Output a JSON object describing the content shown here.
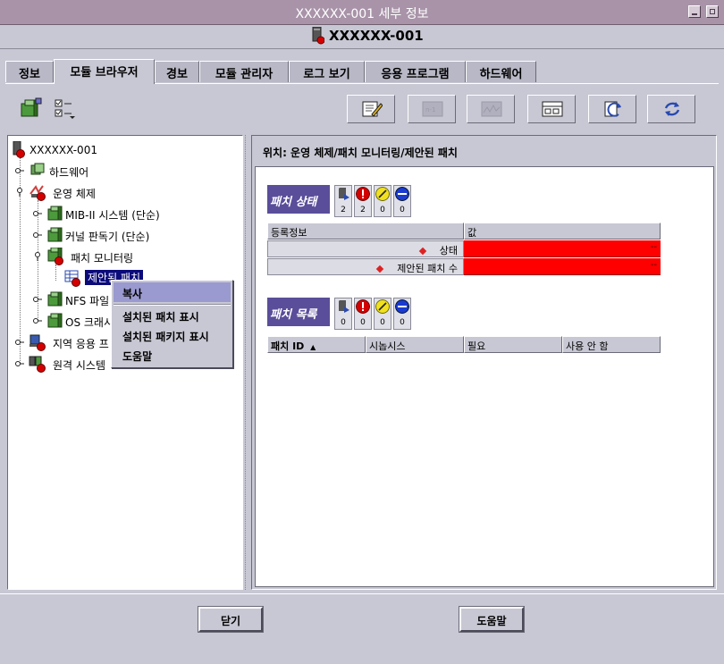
{
  "window": {
    "title": "XXXXXX-001 세부 정보"
  },
  "header": {
    "title": "XXXXXX-001"
  },
  "tabs": [
    {
      "label": "정보"
    },
    {
      "label": "모듈 브라우저"
    },
    {
      "label": "경보"
    },
    {
      "label": "모듈 관리자"
    },
    {
      "label": "로그 보기"
    },
    {
      "label": "응용 프로그램"
    },
    {
      "label": "하드웨어"
    }
  ],
  "tree": {
    "nodes": [
      {
        "label": "XXXXXX-001"
      },
      {
        "label": "하드웨어"
      },
      {
        "label": "운영 체제"
      },
      {
        "label": "MIB-II 시스템 (단순)"
      },
      {
        "label": "커널 판독기 (단순)"
      },
      {
        "label": "패치 모니터링"
      },
      {
        "label": "제안된 패치"
      },
      {
        "label": "NFS 파일"
      },
      {
        "label": "OS 크래시"
      },
      {
        "label": "지역 응용 프"
      },
      {
        "label": "원격 시스템"
      }
    ]
  },
  "context_menu": {
    "items": [
      {
        "label": "복사"
      },
      {
        "label": "설치된 패치 표시"
      },
      {
        "label": "설치된 패키지 표시"
      },
      {
        "label": "도움말"
      }
    ]
  },
  "location": {
    "text": "위치:  운영 체제/패치 모니터링/제안된 패치"
  },
  "patch_status": {
    "label": "패치 상태",
    "counts": [
      "2",
      "2",
      "0",
      "0"
    ],
    "table": {
      "headers": [
        "등록정보",
        "값"
      ],
      "rows": [
        {
          "property": "상태",
          "value": "--"
        },
        {
          "property": "제안된 패치 수",
          "value": "--"
        }
      ]
    }
  },
  "patch_list": {
    "label": "패치 목록",
    "counts": [
      "0",
      "0",
      "0",
      "0"
    ],
    "headers": [
      "패치 ID",
      "시놉시스",
      "필요",
      "사용 안 함"
    ],
    "sort_glyph": "▲"
  },
  "buttons": {
    "close": "닫기",
    "help": "도움말"
  },
  "colors": {
    "title_bar": "#a893a8",
    "panel": "#c8c8d4",
    "section_label": "#5a4e9a",
    "alarm_red": "#ff0000",
    "selection": "#0b0b7a"
  }
}
